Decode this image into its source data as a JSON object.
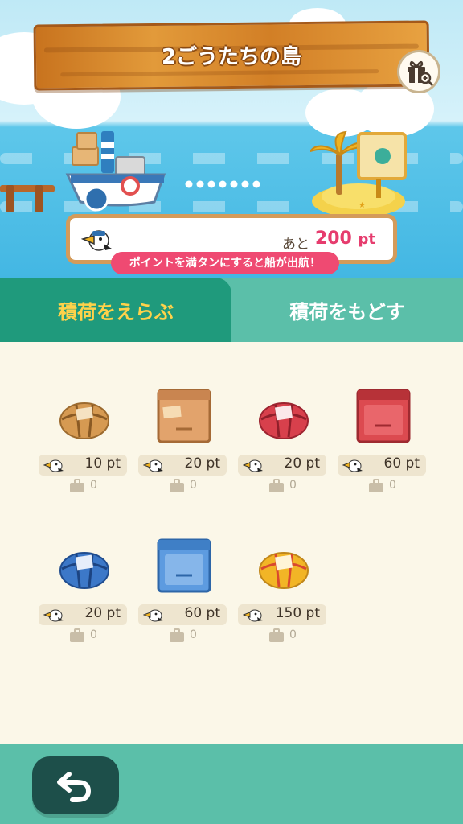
{
  "header": {
    "island_title": "2ごうたちの島",
    "gift_icon": "gift-magnify-icon"
  },
  "scene": {
    "ship_icon": "cargo-ship-icon",
    "island_icon": "palm-island-icon",
    "pier_icon": "wooden-pier-icon"
  },
  "progress": {
    "remain_prefix": "あと",
    "remain_value": "200",
    "remain_unit": "pt",
    "hint": "ポイントを満タンにすると船が出航！"
  },
  "tabs": {
    "select_label": "積荷をえらぶ",
    "return_label": "積荷をもどす"
  },
  "items": [
    {
      "kind": "bundle-tan",
      "price": "10 pt",
      "count": "0"
    },
    {
      "kind": "crate-wood",
      "price": "20 pt",
      "count": "0"
    },
    {
      "kind": "bundle-red",
      "price": "20 pt",
      "count": "0"
    },
    {
      "kind": "crate-red",
      "price": "60 pt",
      "count": "0"
    },
    {
      "kind": "bundle-blue",
      "price": "20 pt",
      "count": "0"
    },
    {
      "kind": "crate-blue",
      "price": "60 pt",
      "count": "0"
    },
    {
      "kind": "bundle-gold",
      "price": "150 pt",
      "count": "0"
    }
  ],
  "footer": {
    "back_icon": "undo-arrow-icon"
  },
  "colors": {
    "accent_green": "#1f9a7c",
    "tab_inactive": "#5bbfa9",
    "highlight_yellow": "#ffd24a",
    "pt_pink": "#e63c6e"
  }
}
